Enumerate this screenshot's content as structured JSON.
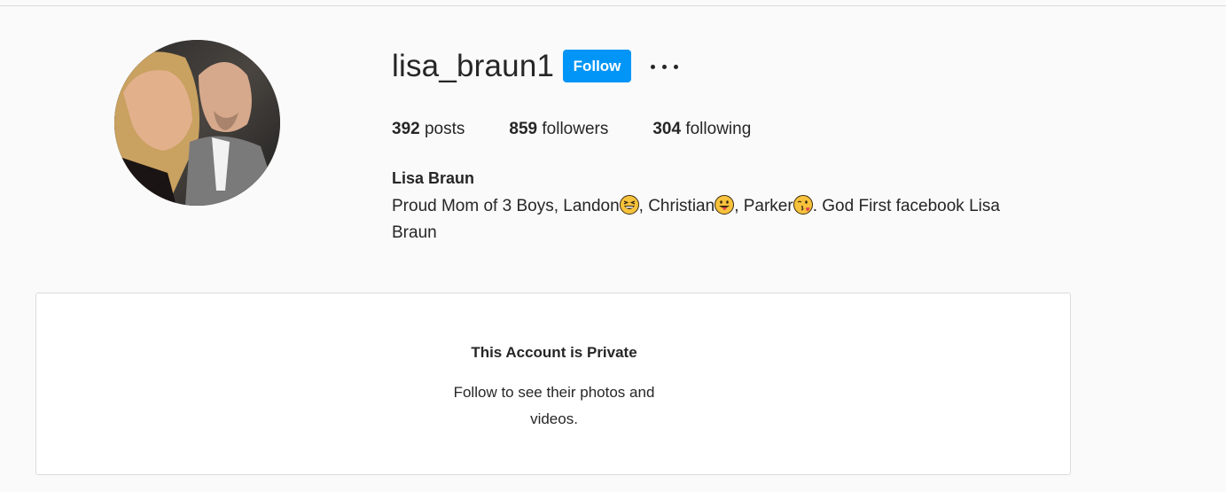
{
  "profile": {
    "username": "lisa_braun1",
    "follow_label": "Follow",
    "posts_count": "392",
    "posts_label": " posts",
    "followers_count": "859",
    "followers_label": " followers",
    "following_count": "304",
    "following_label": " following",
    "full_name": "Lisa Braun",
    "bio": {
      "part1": "Proud Mom of 3 Boys, Landon",
      "emoji1": "grinning-squinting-face",
      "part2": ", Christian",
      "emoji2": "face-with-tongue",
      "part3": ", Parker",
      "emoji3": "face-blowing-kiss",
      "part4": ". God First facebook Lisa Braun"
    }
  },
  "private_notice": {
    "title": "This Account is Private",
    "message": "Follow to see their photos and videos."
  },
  "colors": {
    "accent": "#0095f6",
    "background": "#fafafa",
    "text": "#262626",
    "border": "#dbdbdb"
  }
}
